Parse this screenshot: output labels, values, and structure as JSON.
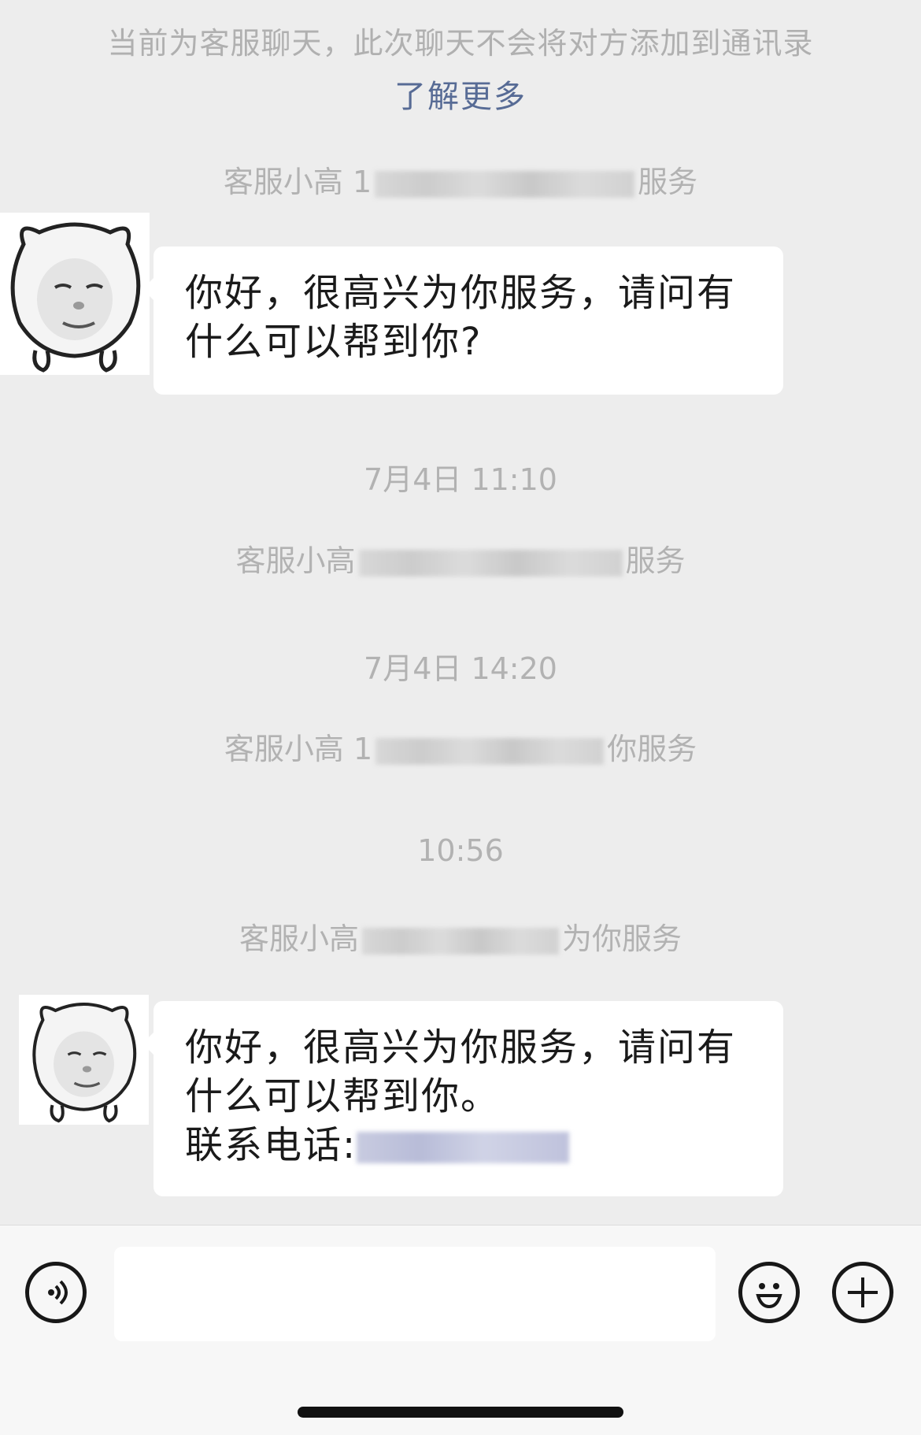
{
  "notice": {
    "text": "当前为客服聊天，此次聊天不会将对方添加到通讯录",
    "link": "了解更多"
  },
  "messages": [
    {
      "system_prefix": "客服小高 1",
      "system_suffix": "服务"
    },
    {
      "bubble_line1": "你好，很高兴为你服务，请问有",
      "bubble_line2": "什么可以帮到你?"
    },
    {
      "time": "7月4日 11:10"
    },
    {
      "system_prefix": "客服小高",
      "system_suffix": "服务"
    },
    {
      "time": "7月4日 14:20"
    },
    {
      "system_prefix": "客服小高 1",
      "system_suffix": "你服务"
    },
    {
      "time": "10:56"
    },
    {
      "system_prefix": "客服小高",
      "system_suffix": "为你服务"
    },
    {
      "bubble_line1": "你好，很高兴为你服务，请问有",
      "bubble_line2": "什么可以帮到你。",
      "bubble_line3": "联系电话:"
    }
  ],
  "input_bar": {
    "voice_icon": "voice-icon",
    "emoji_icon": "emoji-icon",
    "plus_icon": "plus-icon",
    "placeholder": ""
  }
}
